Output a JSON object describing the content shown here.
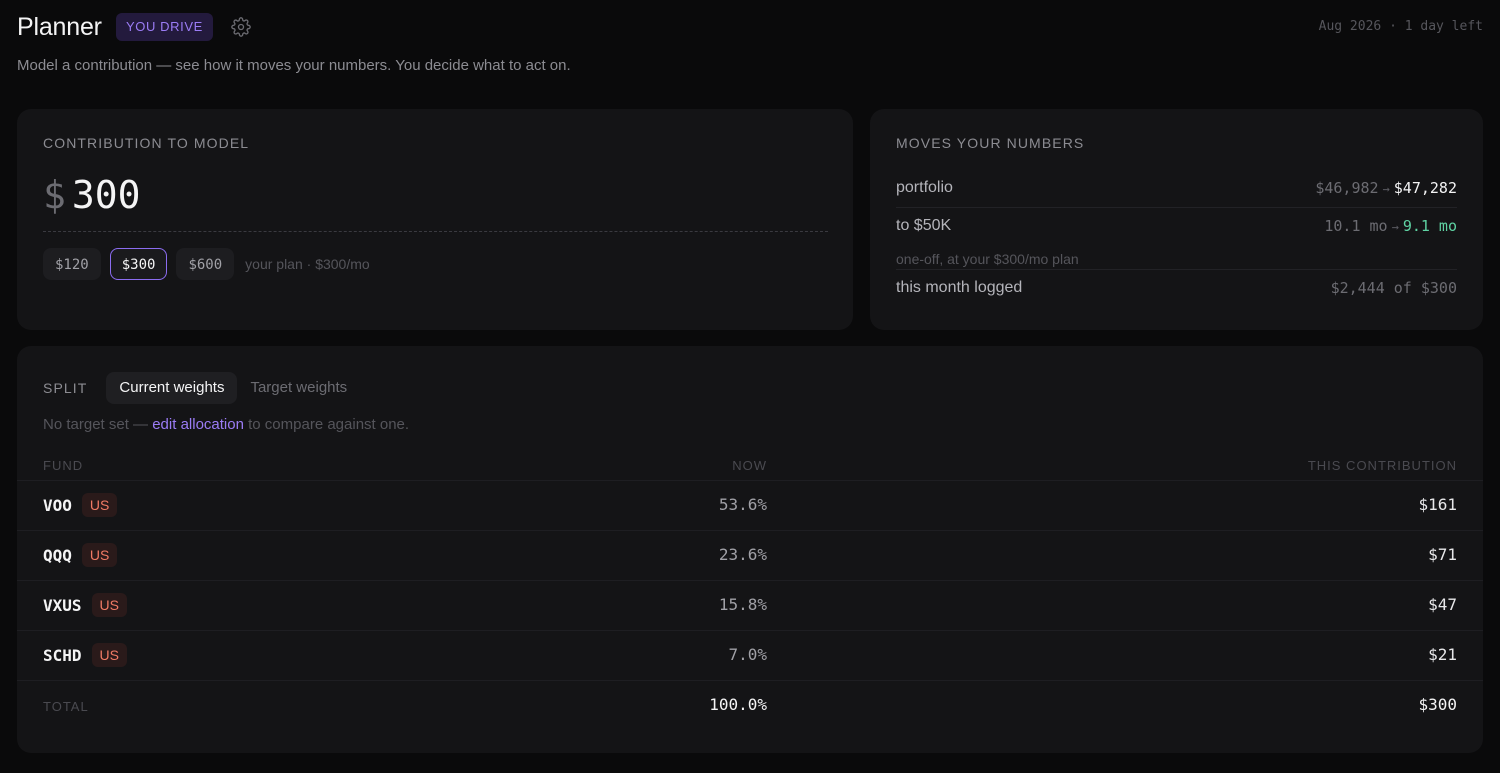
{
  "header": {
    "title": "Planner",
    "badge": "YOU DRIVE",
    "period": "Aug 2026 · 1 day left",
    "subtitle": "Model a contribution — see how it moves your numbers. You decide what to act on."
  },
  "contribution": {
    "label": "CONTRIBUTION TO MODEL",
    "currency": "$",
    "amount": "300",
    "presets": [
      "$120",
      "$300",
      "$600"
    ],
    "selected_preset": "$300",
    "plan_note": "your plan · $300/mo"
  },
  "moves": {
    "label": "MOVES YOUR NUMBERS",
    "portfolio": {
      "label": "portfolio",
      "from": "$46,982",
      "to": "$47,282"
    },
    "goal": {
      "label": "to $50K",
      "from": "10.1 mo",
      "to": "9.1 mo",
      "note": "one-off, at your $300/mo plan"
    },
    "logged": {
      "label": "this month logged",
      "value": "$2,444 of $300"
    }
  },
  "split": {
    "label": "SPLIT",
    "tabs": [
      "Current weights",
      "Target weights"
    ],
    "active_tab": "Current weights",
    "hint_prefix": "No target set —",
    "hint_link": "edit allocation",
    "hint_suffix": "to compare against one.",
    "columns": {
      "fund": "FUND",
      "now": "NOW",
      "contribution": "THIS CONTRIBUTION"
    },
    "rows": [
      {
        "ticker": "VOO",
        "tag": "US",
        "now": "53.6%",
        "contribution": "$161"
      },
      {
        "ticker": "QQQ",
        "tag": "US",
        "now": "23.6%",
        "contribution": "$71"
      },
      {
        "ticker": "VXUS",
        "tag": "US",
        "now": "15.8%",
        "contribution": "$47"
      },
      {
        "ticker": "SCHD",
        "tag": "US",
        "now": "7.0%",
        "contribution": "$21"
      }
    ],
    "total": {
      "label": "TOTAL",
      "now": "100.0%",
      "contribution": "$300"
    }
  },
  "colors": {
    "accent": "#8b6cf0",
    "positive": "#5fd3a3",
    "tag": "#f07a64",
    "background": "#0a0a0b",
    "card": "#141416"
  },
  "icons": {
    "settings": "gear-icon"
  }
}
